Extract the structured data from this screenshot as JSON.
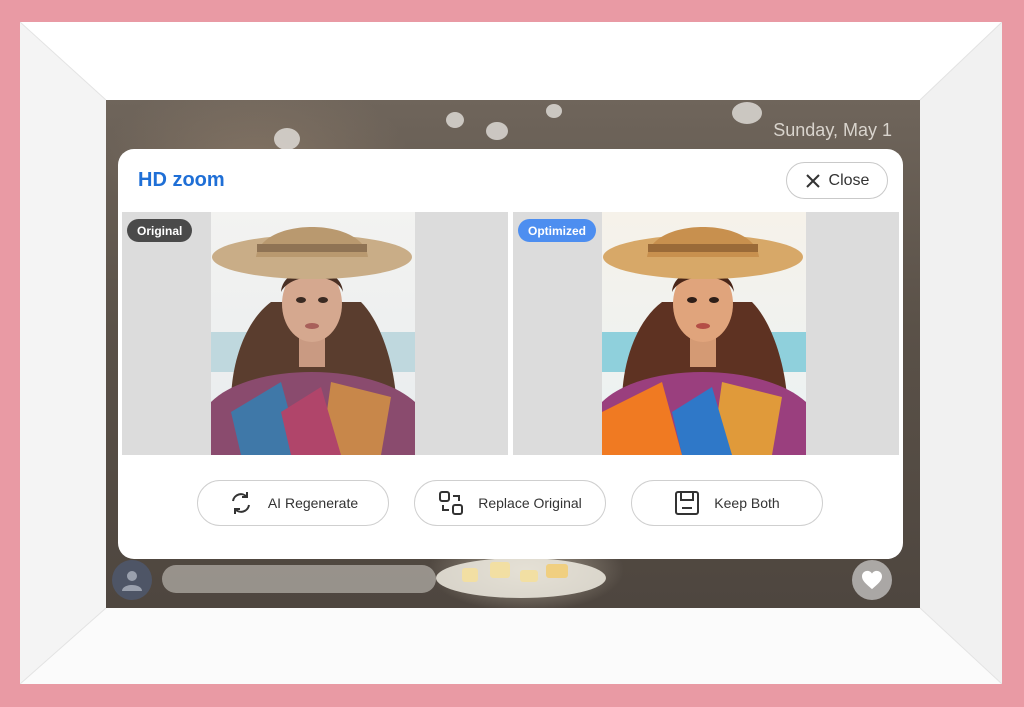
{
  "screen": {
    "date": "Sunday, May 1"
  },
  "dialog": {
    "title": "HD zoom",
    "close_label": "Close",
    "original_badge": "Original",
    "optimized_badge": "Optimized",
    "actions": [
      {
        "label": "AI Regenerate",
        "icon": "refresh-icon"
      },
      {
        "label": "Replace Original",
        "icon": "replace-icon"
      },
      {
        "label": "Keep Both",
        "icon": "save-icon"
      }
    ]
  },
  "colors": {
    "frame": "#e99aa4",
    "title_blue": "#1f6fd6",
    "optimized_badge": "#4d8ef0",
    "original_badge": "#4a4a4a"
  }
}
